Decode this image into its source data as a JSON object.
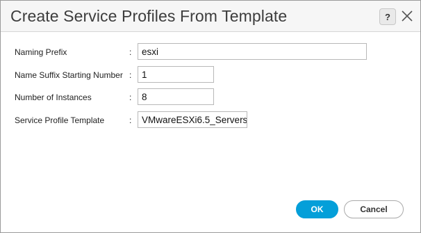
{
  "dialog": {
    "title": "Create Service Profiles From Template",
    "help_label": "?"
  },
  "form": {
    "colon": ":",
    "fields": [
      {
        "label": "Naming Prefix",
        "value": "esxi"
      },
      {
        "label": "Name Suffix Starting Number",
        "value": "1"
      },
      {
        "label": "Number of Instances",
        "value": "8"
      },
      {
        "label": "Service Profile Template",
        "value": "VMwareESXi6.5_Servers"
      }
    ]
  },
  "buttons": {
    "ok_label": "OK",
    "cancel_label": "Cancel"
  },
  "icons": {
    "help": "question-icon",
    "close": "close-icon"
  },
  "colors": {
    "primary": "#049fd9",
    "header_bg": "#f6f6f6",
    "border": "#b8b8b8"
  }
}
